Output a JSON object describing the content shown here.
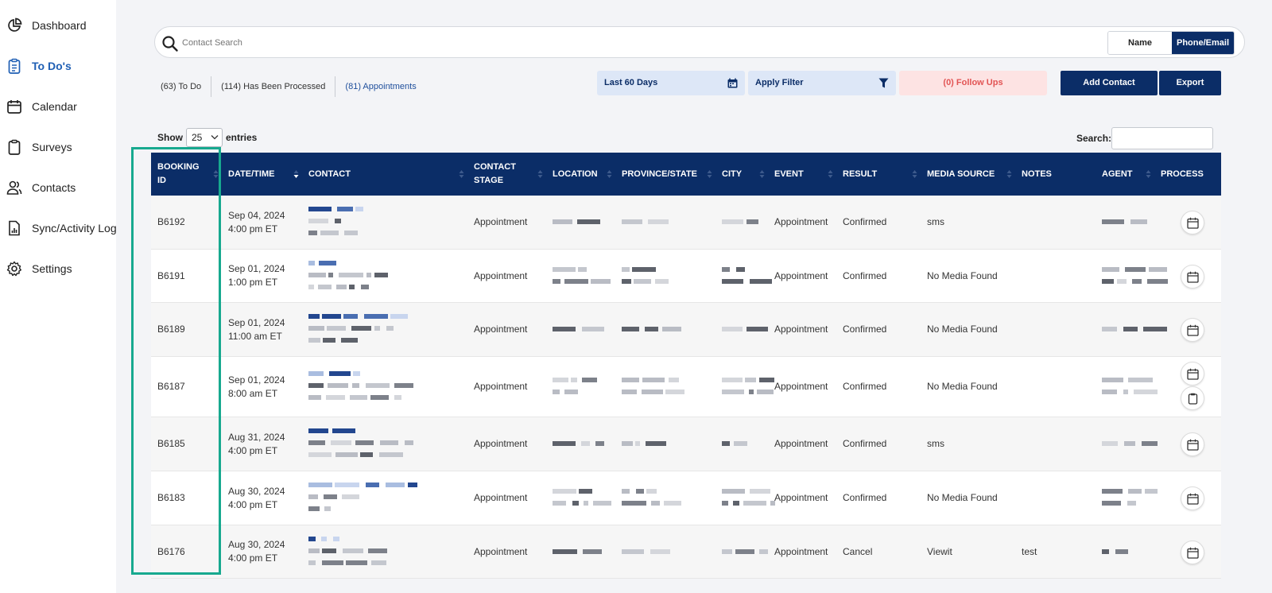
{
  "sidebar": {
    "items": [
      {
        "label": "Dashboard",
        "icon": "pie-chart-icon"
      },
      {
        "label": "To Do's",
        "icon": "clipboard-list-icon",
        "active": true
      },
      {
        "label": "Calendar",
        "icon": "calendar-icon"
      },
      {
        "label": "Surveys",
        "icon": "clipboard-icon"
      },
      {
        "label": "Contacts",
        "icon": "users-icon"
      },
      {
        "label": "Sync/Activity Log",
        "icon": "file-chart-icon"
      },
      {
        "label": "Settings",
        "icon": "gear-icon"
      }
    ]
  },
  "search": {
    "placeholder": "Contact Search",
    "toggle": {
      "name_label": "Name",
      "phone_label": "Phone/Email",
      "selected": "Phone/Email"
    }
  },
  "counts": {
    "todo": "(63) To Do",
    "processed": "(114) Has Been Processed",
    "appointments": "(81) Appointments"
  },
  "filters": {
    "date_range": "Last 60 Days",
    "apply_filter": "Apply Filter",
    "follow_ups": "(0) Follow Ups"
  },
  "actions": {
    "add_contact": "Add Contact",
    "export": "Export"
  },
  "table_controls": {
    "show_label": "Show",
    "page_size": "25",
    "entries_label": "entries",
    "search_label": "Search:"
  },
  "table": {
    "columns": [
      "BOOKING ID",
      "DATE/TIME",
      "CONTACT",
      "CONTACT STAGE",
      "LOCATION",
      "PROVINCE/STATE",
      "CITY",
      "EVENT",
      "RESULT",
      "MEDIA SOURCE",
      "NOTES",
      "AGENT",
      "PROCESS"
    ],
    "rows": [
      {
        "booking_id": "B6192",
        "date": "Sep 04, 2024",
        "time": "4:00 pm ET",
        "stage": "Appointment",
        "event": "Appointment",
        "result": "Confirmed",
        "media_source": "sms",
        "notes": ""
      },
      {
        "booking_id": "B6191",
        "date": "Sep 01, 2024",
        "time": "1:00 pm ET",
        "stage": "Appointment",
        "event": "Appointment",
        "result": "Confirmed",
        "media_source": "No Media Found",
        "notes": ""
      },
      {
        "booking_id": "B6189",
        "date": "Sep 01, 2024",
        "time": "11:00 am ET",
        "stage": "Appointment",
        "event": "Appointment",
        "result": "Confirmed",
        "media_source": "No Media Found",
        "notes": ""
      },
      {
        "booking_id": "B6187",
        "date": "Sep 01, 2024",
        "time": "8:00 am ET",
        "stage": "Appointment",
        "event": "Appointment",
        "result": "Confirmed",
        "media_source": "No Media Found",
        "notes": ""
      },
      {
        "booking_id": "B6185",
        "date": "Aug 31, 2024",
        "time": "4:00 pm ET",
        "stage": "Appointment",
        "event": "Appointment",
        "result": "Confirmed",
        "media_source": "sms",
        "notes": ""
      },
      {
        "booking_id": "B6183",
        "date": "Aug 30, 2024",
        "time": "4:00 pm ET",
        "stage": "Appointment",
        "event": "Appointment",
        "result": "Confirmed",
        "media_source": "No Media Found",
        "notes": ""
      },
      {
        "booking_id": "B6176",
        "date": "Aug 30, 2024",
        "time": "4:00 pm ET",
        "stage": "Appointment",
        "event": "Appointment",
        "result": "Cancel",
        "media_source": "Viewit",
        "notes": "test"
      }
    ]
  },
  "colors": {
    "brand_navy": "#0b2d67",
    "active_link": "#1f5fb4",
    "follow_up_red": "#e25454",
    "highlight_teal": "#17a98f"
  }
}
